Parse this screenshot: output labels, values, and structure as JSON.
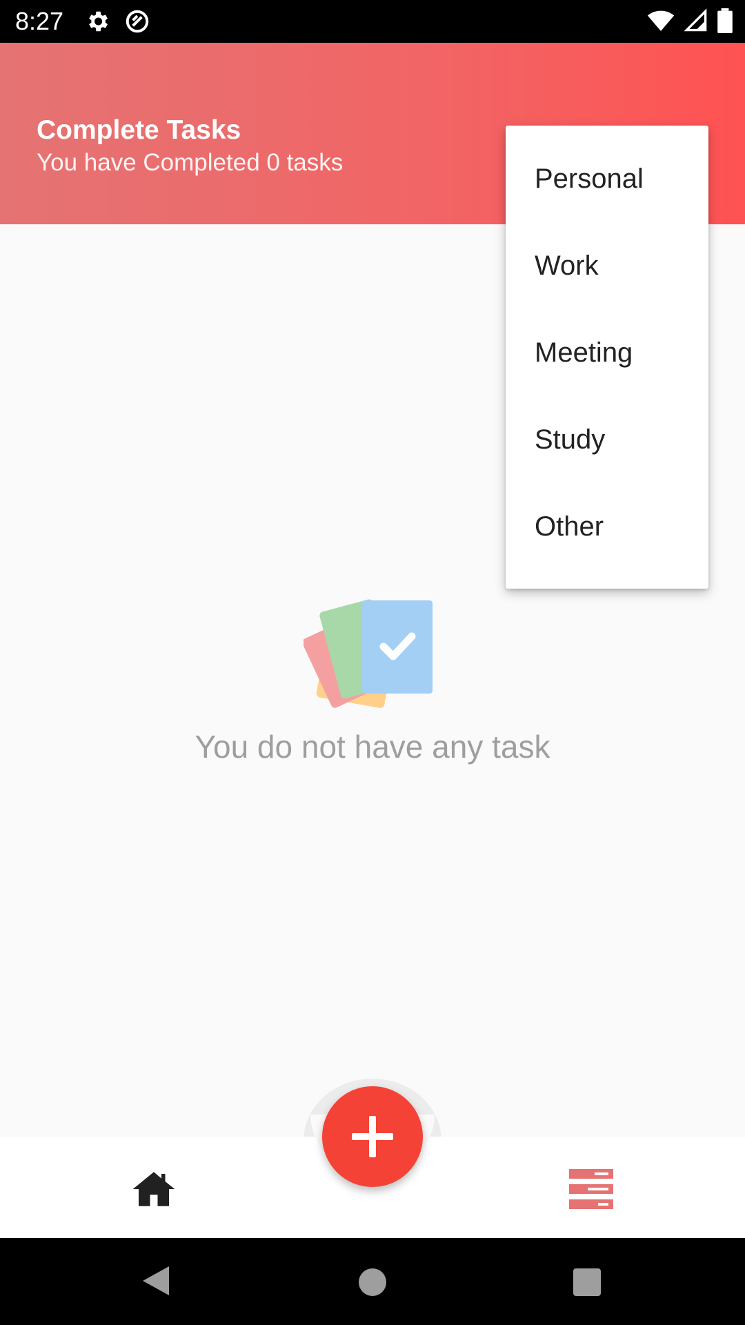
{
  "status_bar": {
    "time": "8:27"
  },
  "header": {
    "title": "Complete Tasks",
    "subtitle": "You have Completed 0 tasks"
  },
  "menu": {
    "items": [
      "Personal",
      "Work",
      "Meeting",
      "Study",
      "Other"
    ]
  },
  "empty_state": {
    "message": "You do not have any task"
  },
  "icons": {
    "settings": "gear-icon",
    "sync": "sync-icon",
    "wifi": "wifi-icon",
    "signal": "signal-icon",
    "battery": "battery-icon",
    "add": "plus-icon",
    "home": "home-icon",
    "tasks": "task-list-icon",
    "back": "back-icon",
    "system_home": "circle-icon",
    "recent": "square-icon"
  },
  "colors": {
    "header_start": "#e57373",
    "header_end": "#ff5252",
    "fab": "#f44336",
    "tasks_icon": "#e57373"
  }
}
